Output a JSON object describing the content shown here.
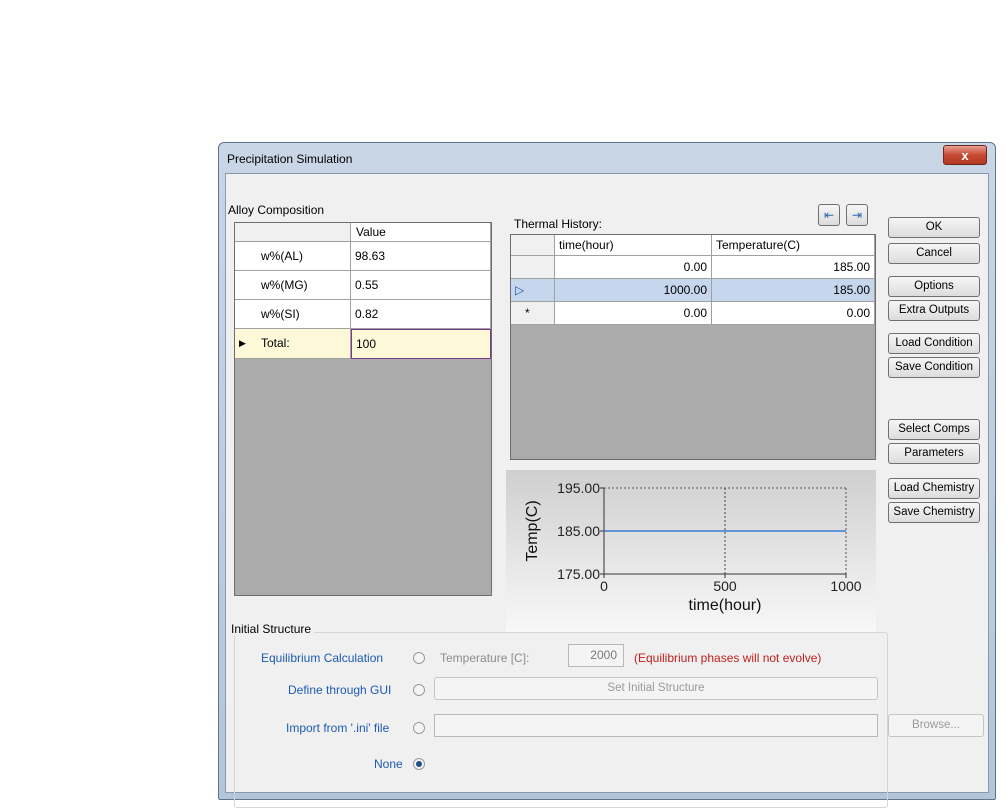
{
  "window": {
    "title": "Precipitation Simulation",
    "close_glyph": "x"
  },
  "alloy": {
    "section_label": "Alloy Composition",
    "header": "Value",
    "rows": [
      {
        "name": "w%(AL)",
        "value": "98.63"
      },
      {
        "name": "w%(MG)",
        "value": "0.55"
      },
      {
        "name": "w%(SI)",
        "value": "0.82"
      }
    ],
    "total": {
      "name": "Total:",
      "value": "100"
    }
  },
  "thermal": {
    "section_label": "Thermal History:",
    "headers": [
      "time(hour)",
      "Temperature(C)"
    ],
    "rows": [
      {
        "marker": "",
        "time": "0.00",
        "temp": "185.00"
      },
      {
        "marker": "▷",
        "time": "1000.00",
        "temp": "185.00"
      },
      {
        "marker": "*",
        "time": "0.00",
        "temp": "0.00"
      }
    ],
    "import_icon": "import-table-icon",
    "export_icon": "export-table-icon"
  },
  "chart_data": {
    "type": "line",
    "xlabel": "time(hour)",
    "ylabel": "Temp(C)",
    "x_ticks": [
      "0",
      "500",
      "1000"
    ],
    "y_ticks": [
      "195.00",
      "185.00",
      "175.00"
    ],
    "xlim": [
      0,
      1000
    ],
    "ylim": [
      175,
      195
    ],
    "series": [
      {
        "x": [
          0,
          1000
        ],
        "y": [
          185,
          185
        ],
        "color": "#3a7bd5"
      }
    ],
    "grid": true
  },
  "buttons": {
    "ok": "OK",
    "cancel": "Cancel",
    "options": "Options",
    "extra_outputs": "Extra Outputs",
    "load_condition": "Load Condition",
    "save_condition": "Save Condition",
    "select_comps": "Select Comps",
    "parameters": "Parameters",
    "load_chemistry": "Load Chemistry",
    "save_chemistry": "Save Chemistry"
  },
  "initial": {
    "section_label": "Initial Structure",
    "equilibrium_label": "Equilibrium Calculation",
    "temperature_label": "Temperature [C]:",
    "temperature_value": "2000",
    "warning": "(Equilibrium phases will not evolve)",
    "gui_label": "Define through GUI",
    "set_initial_button": "Set Initial Structure",
    "import_label": "Import from '.ini' file",
    "import_value": "",
    "browse_button": "Browse...",
    "none_label": "None"
  }
}
